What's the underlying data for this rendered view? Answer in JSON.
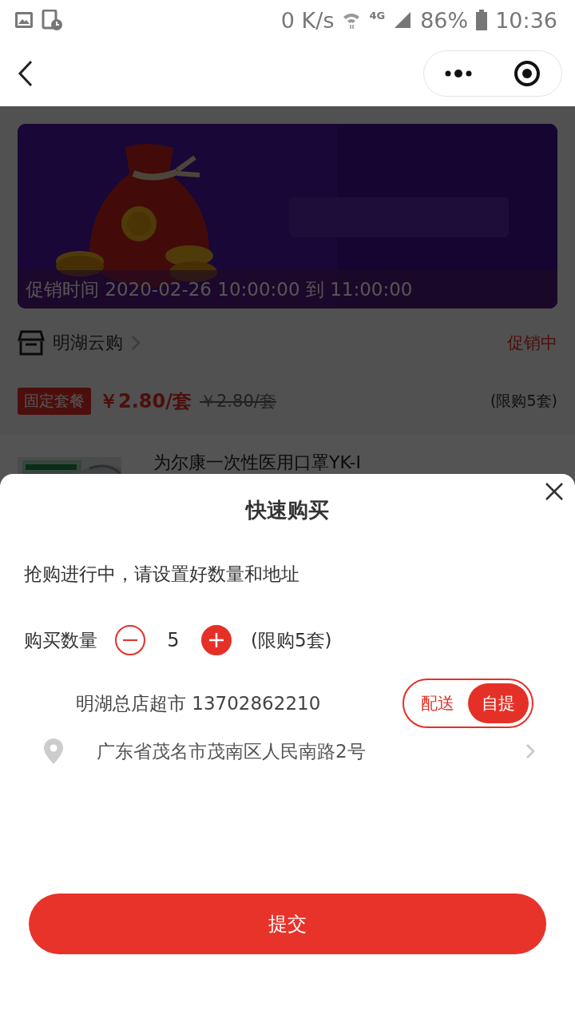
{
  "status_bar": {
    "speed": "0 K/s",
    "network": "4G",
    "battery": "86%",
    "time": "10:36"
  },
  "promo": {
    "caption": "促销时间 2020-02-26 10:00:00 到 11:00:00"
  },
  "shop": {
    "name": "明湖云购",
    "status": "促销中"
  },
  "price_row": {
    "tag": "固定套餐",
    "price": "￥2.80/套",
    "original_price": "￥2.80/套",
    "limit": "(限购5套)"
  },
  "product": {
    "name": "为尔康一次性医用口罩YK-I"
  },
  "sheet": {
    "title": "快速购买",
    "notice": "抢购进行中，请设置好数量和地址",
    "quantity": {
      "label": "购买数量",
      "value": "5",
      "limit": "(限购5套)"
    },
    "store": "明湖总店超市 13702862210",
    "delivery_options": [
      {
        "label": "配送",
        "selected": false
      },
      {
        "label": "自提",
        "selected": true
      }
    ],
    "address": "广东省茂名市茂南区人民南路2号",
    "submit": "提交"
  }
}
